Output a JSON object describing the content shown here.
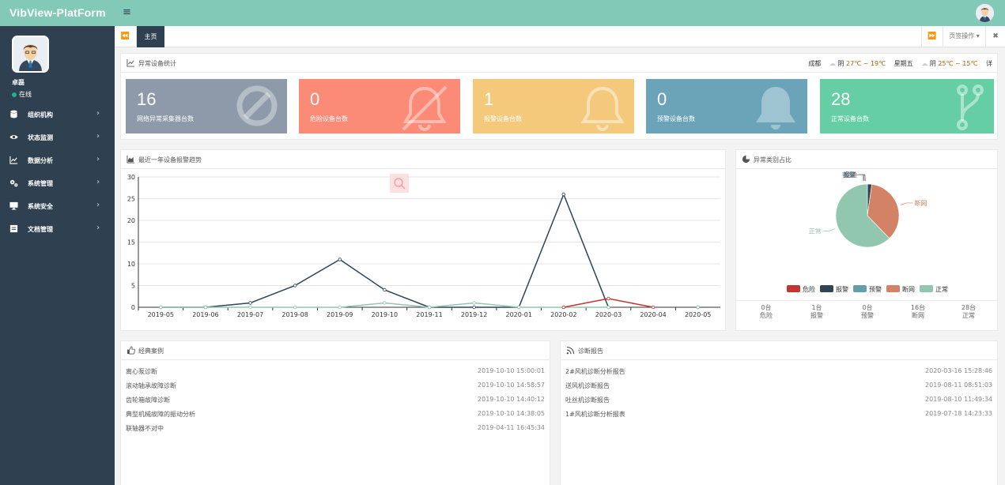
{
  "app": {
    "title": "VibView-PlatForm"
  },
  "user": {
    "name": "卓磊",
    "status": "在线"
  },
  "nav": [
    {
      "label": "组织机构",
      "icon": "database-icon"
    },
    {
      "label": "状态监测",
      "icon": "eye-icon"
    },
    {
      "label": "数据分析",
      "icon": "line-chart-icon"
    },
    {
      "label": "系统管理",
      "icon": "gears-icon"
    },
    {
      "label": "系统安全",
      "icon": "monitor-icon"
    },
    {
      "label": "文档管理",
      "icon": "document-icon"
    }
  ],
  "tabs": {
    "home": "主页",
    "ops": "页签操作"
  },
  "stats": {
    "title": "异常设备统计",
    "weather": {
      "city": "成都",
      "today_cond": "阴",
      "today_temp": "27℃ ~ 19℃",
      "weekday": "星期五",
      "tomorrow_cond": "阴",
      "tomorrow_temp": "25℃ ~ 15℃",
      "tail": "详"
    },
    "cards": [
      {
        "value": "16",
        "label": "网络异常采集器台数",
        "color": "#8e9aa9",
        "icon": "ban-icon"
      },
      {
        "value": "0",
        "label": "危险设备台数",
        "color": "#fb8b77",
        "icon": "bell-slash-icon"
      },
      {
        "value": "1",
        "label": "报警设备台数",
        "color": "#f4c97c",
        "icon": "bell-outline-icon"
      },
      {
        "value": "0",
        "label": "预警设备台数",
        "color": "#6ba4b9",
        "icon": "bell-icon"
      },
      {
        "value": "28",
        "label": "正常设备台数",
        "color": "#66cea4",
        "icon": "branch-icon"
      }
    ]
  },
  "trend": {
    "title": "最近一年设备报警趋势"
  },
  "pie": {
    "title": "异常类别占比"
  },
  "chart_data": [
    {
      "type": "line",
      "x": [
        "2019-05",
        "2019-06",
        "2019-07",
        "2019-08",
        "2019-09",
        "2019-10",
        "2019-11",
        "2019-12",
        "2020-01",
        "2020-02",
        "2020-03",
        "2020-04",
        "2020-05"
      ],
      "ylim": [
        0,
        30
      ],
      "yticks": [
        0,
        5,
        10,
        15,
        20,
        25,
        30
      ],
      "series": [
        {
          "color": "#2f4554",
          "values": [
            0,
            0,
            1,
            5,
            11,
            4,
            0,
            0,
            0,
            26,
            0,
            null,
            0
          ]
        },
        {
          "color": "#91c7ae",
          "values": [
            0,
            0,
            0,
            0,
            0,
            1,
            0,
            1,
            0,
            0,
            0,
            null,
            0
          ]
        },
        {
          "color": "#c23531",
          "values": [
            null,
            null,
            null,
            null,
            null,
            null,
            null,
            null,
            null,
            0,
            2,
            0,
            null
          ]
        }
      ]
    },
    {
      "type": "pie",
      "slices": [
        {
          "name": "危险",
          "value": 0,
          "color": "#c23531"
        },
        {
          "name": "报警",
          "value": 1,
          "color": "#2f4554"
        },
        {
          "name": "预警",
          "value": 0,
          "color": "#61a0a8"
        },
        {
          "name": "断网",
          "value": 16,
          "color": "#d48265"
        },
        {
          "name": "正常",
          "value": 28,
          "color": "#91c7ae"
        }
      ],
      "legend": "bottom"
    }
  ],
  "pie_stats": [
    {
      "count": "0台",
      "label": "危险"
    },
    {
      "count": "1台",
      "label": "报警"
    },
    {
      "count": "0台",
      "label": "预警"
    },
    {
      "count": "16台",
      "label": "断网"
    },
    {
      "count": "28台",
      "label": "正常"
    }
  ],
  "cases": {
    "title": "经典案例",
    "items": [
      {
        "name": "离心泵诊断",
        "time": "2019-10-10 15:00:01"
      },
      {
        "name": "滚动轴承故障诊断",
        "time": "2019-10-10 14:58:57"
      },
      {
        "name": "齿轮箱故障诊断",
        "time": "2019-10-10 14:40:12"
      },
      {
        "name": "典型机械故障的振动分析",
        "time": "2019-10-10 14:38:05"
      },
      {
        "name": "联轴器不对中",
        "time": "2019-04-11 16:45:34"
      }
    ]
  },
  "reports": {
    "title": "诊断报告",
    "items": [
      {
        "name": "2#风机诊断分析报告",
        "time": "2020-03-16 15:28:46"
      },
      {
        "name": "送风机诊断报告",
        "time": "2019-08-11 08:51:03"
      },
      {
        "name": "吐丝机诊断报告",
        "time": "2019-08-10 11:49:34"
      },
      {
        "name": "1#风机诊断分析报表",
        "time": "2019-07-18 14:23:33"
      }
    ]
  }
}
